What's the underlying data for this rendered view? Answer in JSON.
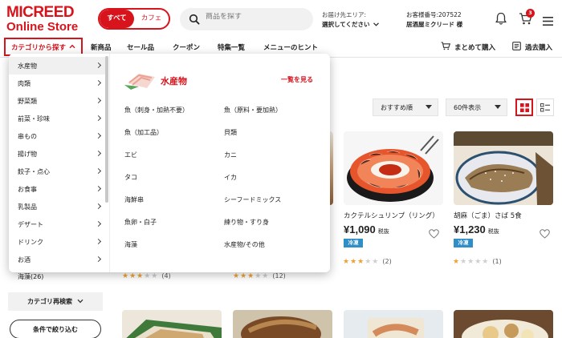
{
  "brand": {
    "line1": "MICREED",
    "line2": "Online Store",
    "color": "#d7131c"
  },
  "store_toggle": {
    "all": "すべて",
    "cafe": "カフェ"
  },
  "search": {
    "placeholder": "商品を探す"
  },
  "delivery": {
    "label": "お届け先エリア:",
    "value": "選択してください"
  },
  "customer": {
    "label": "お客様番号:207522",
    "name": "居酒屋ミクリード 様"
  },
  "cart": {
    "count": "3"
  },
  "icons": [
    "search-icon",
    "bell-icon",
    "cart-icon",
    "menu-icon",
    "chevron-down-icon",
    "cart-bulk-icon",
    "history-icon",
    "heart-icon",
    "grid-view-icon",
    "list-view-icon"
  ],
  "nav": {
    "category_button": "カテゴリから探す",
    "items": [
      "新商品",
      "セール品",
      "クーポン",
      "特集一覧",
      "メニューのヒント"
    ],
    "bulk_buy": "まとめて購入",
    "history": "過去購入"
  },
  "sort": {
    "order": "おすすめ順",
    "per_page": "60件表示"
  },
  "categories": [
    "水産物",
    "肉類",
    "野菜類",
    "前菜・珍味",
    "串もの",
    "揚げ物",
    "餃子・点心",
    "お食事",
    "乳製品",
    "デザート",
    "ドリンク",
    "お酒"
  ],
  "mega": {
    "title": "水産物",
    "see_all": "一覧を見る",
    "subs": [
      "魚（刺身・加熱不要）",
      "魚（原料・要加熱）",
      "魚（加工品）",
      "貝類",
      "エビ",
      "カニ",
      "タコ",
      "イカ",
      "海鮮串",
      "シーフードミックス",
      "魚卵・白子",
      "練り物・すり身",
      "海藻",
      "水産物/その他"
    ]
  },
  "products": [
    {
      "name": "カクテルシュリンプ（リング）",
      "price": "¥1,090",
      "tax": "税抜",
      "tag": "冷凍",
      "rating": 3,
      "count": "(2)"
    },
    {
      "name": "胡麻（ごま）さば 5食",
      "price": "¥1,230",
      "tax": "税抜",
      "tag": "冷凍",
      "rating": 1,
      "count": "(1)"
    }
  ],
  "hidden_ratings": [
    {
      "rating": 3,
      "count": "(4)"
    },
    {
      "rating": 3,
      "count": "(12)"
    }
  ],
  "sidebar": {
    "last_item": "海藻(26)",
    "refine": "カテゴリ再検索",
    "filter": "条件で絞り込む"
  }
}
